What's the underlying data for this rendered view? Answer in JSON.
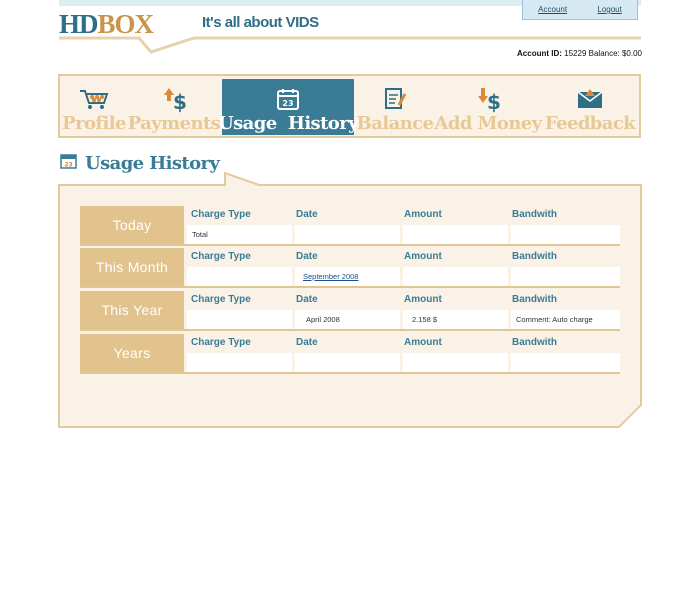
{
  "header": {
    "logo_hd": "HD",
    "logo_box": "BOX",
    "tagline": "It's all about VIDS",
    "links": {
      "account": "Account",
      "logout": "Logout"
    },
    "account_label": "Account ID:",
    "account_value": "15229 Balance: $0.00"
  },
  "nav": {
    "items": [
      {
        "label": "Profile",
        "icon": "cart-icon"
      },
      {
        "label": "Payments",
        "icon": "dollar-arrow-icon"
      },
      {
        "label": "Usage  History",
        "icon": "calendar-icon",
        "active": true
      },
      {
        "label": "Balance",
        "icon": "document-edit-icon"
      },
      {
        "label": "Add Money",
        "icon": "dollar-down-icon"
      },
      {
        "label": "Feedback",
        "icon": "envelope-icon"
      }
    ]
  },
  "section": {
    "title": "Usage History",
    "icon_day": "23"
  },
  "table": {
    "columns": [
      "Charge Type",
      "Date",
      "Amount",
      "Bandwith"
    ],
    "rows": [
      {
        "label": "Today",
        "cells": [
          "Total",
          "",
          "",
          ""
        ]
      },
      {
        "label": "This Month",
        "cells": [
          "",
          "September 2008",
          "",
          ""
        ]
      },
      {
        "label": "This Year",
        "cells": [
          "",
          "April 2008",
          "2.158 $",
          "Comment: Auto charge"
        ]
      },
      {
        "label": "Years",
        "cells": [
          "",
          "",
          "",
          ""
        ]
      }
    ]
  },
  "colors": {
    "primary": "#3a7c95",
    "accent": "#c8954a",
    "panel_bg": "#faf2e7",
    "panel_border": "#e3c99e"
  }
}
